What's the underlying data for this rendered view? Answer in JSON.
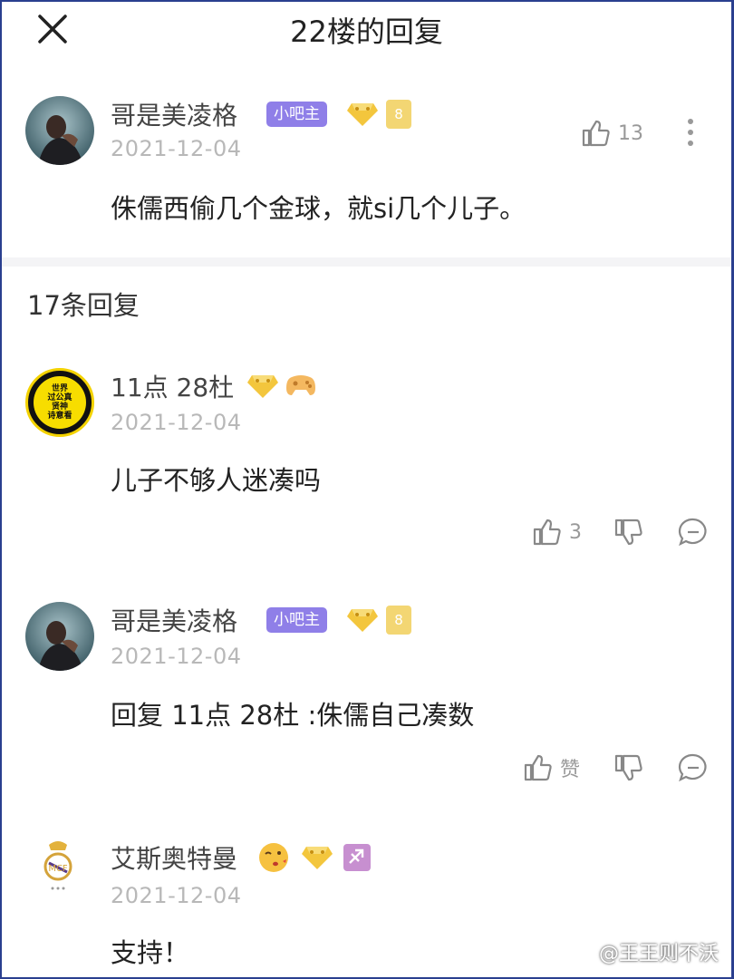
{
  "header": {
    "title": "22楼的回复"
  },
  "main_post": {
    "user": "哥是美凌格",
    "badge": "小吧主",
    "level": "8",
    "date": "2021-12-04",
    "content": "侏儒西偷几个金球，就si几个儿子。",
    "likes": "13"
  },
  "replies_count": "17条回复",
  "replies": [
    {
      "user": "11点 28杜",
      "avatar_text": [
        "世界",
        "过公真",
        "贤神",
        "诗意看"
      ],
      "date": "2021-12-04",
      "content": "儿子不够人迷凑吗",
      "likes": "3"
    },
    {
      "user": "哥是美凌格",
      "badge": "小吧主",
      "level": "8",
      "date": "2021-12-04",
      "content": "回复 11点 28杜 :侏儒自己凑数",
      "likes": "赞"
    },
    {
      "user": "艾斯奥特曼",
      "date": "2021-12-04",
      "content": "支持！"
    }
  ],
  "watermark": "@王王则不沃",
  "colors": {
    "badge_purple": "#8f7fe8",
    "level_gold": "#f3d673",
    "date_gray": "#b8b8b8"
  }
}
